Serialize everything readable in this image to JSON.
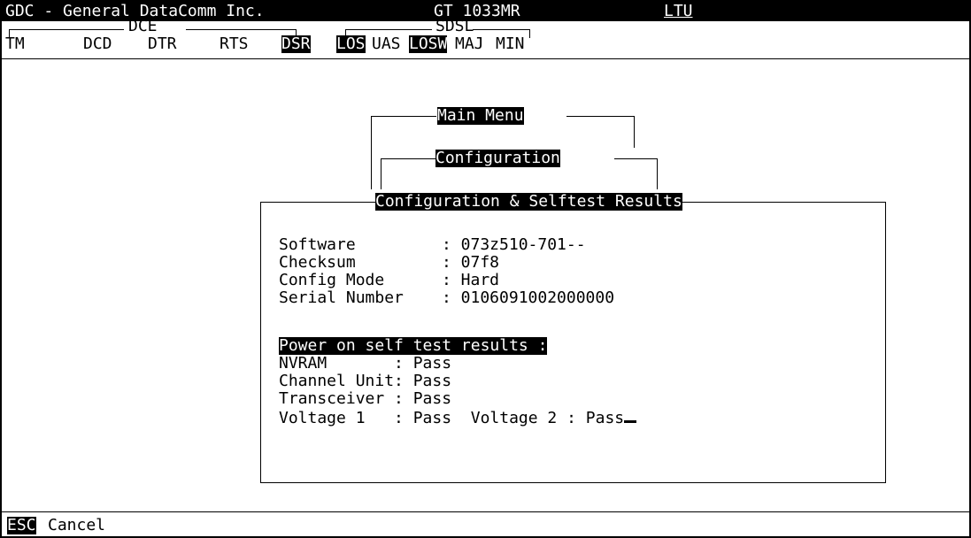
{
  "header": {
    "company": "GDC - General DataComm Inc.",
    "model": "GT 1033MR",
    "unit": "LTU"
  },
  "status": {
    "tm": "TM",
    "dce_group": "DCE",
    "dcd": "DCD",
    "dtr": "DTR",
    "rts": "RTS",
    "dsr": "DSR",
    "sdsl_group": "SDSL",
    "los": "LOS",
    "uas": "UAS",
    "losw": "LOSW",
    "maj": "MAJ",
    "min": "MIN"
  },
  "menus": {
    "main": "Main Menu",
    "configuration": "Configuration",
    "results_title": "Configuration & Selftest Results"
  },
  "info": {
    "software_label": "Software      ",
    "software_value": ": 073z510-701--",
    "checksum_label": "Checksum      ",
    "checksum_value": ": 07f8",
    "config_mode_label": "Config Mode   ",
    "config_mode_value": ": Hard",
    "serial_label": "Serial Number ",
    "serial_value": ": 0106091002000000"
  },
  "selftest": {
    "heading": "Power on self test results :",
    "nvram": "NVRAM       : Pass",
    "channel_unit": "Channel Unit: Pass",
    "transceiver": "Transceiver : Pass",
    "voltage": "Voltage 1   : Pass  Voltage 2 : Pass"
  },
  "footer": {
    "esc_key": "ESC",
    "cancel": "Cancel"
  }
}
